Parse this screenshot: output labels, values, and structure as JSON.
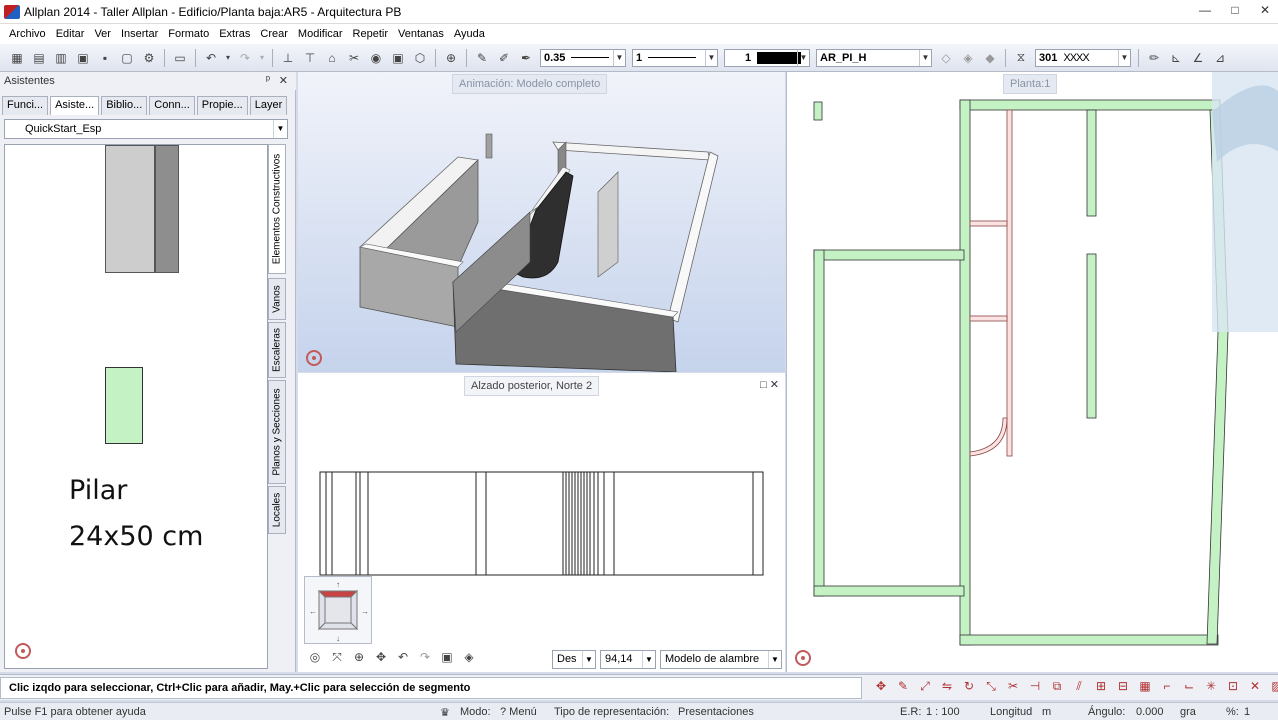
{
  "window": {
    "title": "Allplan 2014 - Taller Allplan - Edificio/Planta baja:AR5 - Arquitectura PB",
    "controls": [
      "—",
      "□",
      "✕"
    ]
  },
  "menu": [
    "Archivo",
    "Editar",
    "Ver",
    "Insertar",
    "Formato",
    "Extras",
    "Crear",
    "Modificar",
    "Repetir",
    "Ventanas",
    "Ayuda"
  ],
  "toolbar": {
    "pen_thickness": "0.35",
    "line_type": "1",
    "color": "1",
    "layer": "AR_PI_H",
    "hatch": "301"
  },
  "left_panel": {
    "title": "Asistentes",
    "pin": "ᵖ",
    "close": "✕",
    "tabs": [
      "Funci...",
      "Asiste...",
      "Biblio...",
      "Conn...",
      "Propie...",
      "Layer"
    ],
    "active_tab": "Asiste...",
    "combo_value": "QuickStart_Esp",
    "vertical_tabs": [
      "Elementos Constructivos",
      "Vanos",
      "Escaleras",
      "Planos y Secciones",
      "Locales"
    ],
    "caption_line1": "Pilar",
    "caption_line2": "24x50 cm"
  },
  "viewports": {
    "model_3d_label": "Animación: Modelo completo",
    "elevation_label": "Alzado posterior, Norte 2",
    "plan_label": "Planta:1",
    "elevation_controls": {
      "des_value": "Des",
      "angle_value": "94,14",
      "render_mode": "Modelo de alambre"
    }
  },
  "command_bar": {
    "prompt": "Clic izqdo para seleccionar, Ctrl+Clic para añadir, May.+Clic para selección de segmento"
  },
  "status_bar": {
    "help": "Pulse F1 para obtener ayuda",
    "mode_label": "Modo:",
    "mode_value": "? Menú",
    "rep_label": "Tipo de representación:",
    "rep_value": "Presentaciones",
    "scale_label": "E.R:",
    "scale_value": "1 : 100",
    "length_label": "Longitud",
    "length_unit": "m",
    "angle_label": "Ángulo:",
    "angle_value": "0.000",
    "angle_unit": "gra",
    "percent_label": "%:",
    "percent_value": "1"
  }
}
